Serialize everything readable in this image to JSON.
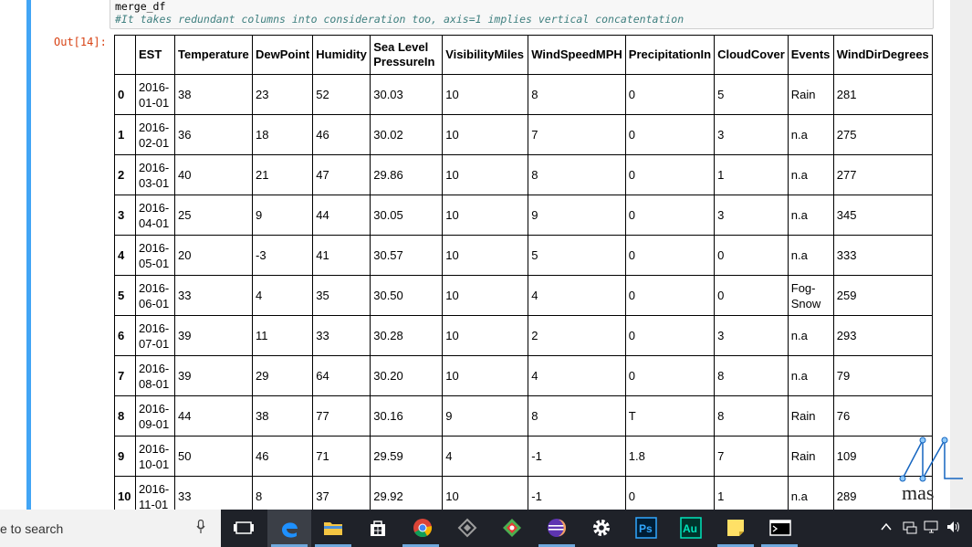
{
  "notebook": {
    "code_line_1": "merge_df",
    "code_line_2": "#It takes redundant columns into consideration too, axis=1 implies vertical concatentation",
    "out_prompt": "Out[14]:"
  },
  "table": {
    "columns": [
      "EST",
      "Temperature",
      "DewPoint",
      "Humidity",
      "Sea Level PressureIn",
      "VisibilityMiles",
      "WindSpeedMPH",
      "PrecipitationIn",
      "CloudCover",
      "Events",
      "WindDirDegrees"
    ],
    "rows": [
      {
        "index": "0",
        "cells": [
          "2016-01-01",
          "38",
          "23",
          "52",
          "30.03",
          "10",
          "8",
          "0",
          "5",
          "Rain",
          "281"
        ]
      },
      {
        "index": "1",
        "cells": [
          "2016-02-01",
          "36",
          "18",
          "46",
          "30.02",
          "10",
          "7",
          "0",
          "3",
          "n.a",
          "275"
        ]
      },
      {
        "index": "2",
        "cells": [
          "2016-03-01",
          "40",
          "21",
          "47",
          "29.86",
          "10",
          "8",
          "0",
          "1",
          "n.a",
          "277"
        ]
      },
      {
        "index": "3",
        "cells": [
          "2016-04-01",
          "25",
          "9",
          "44",
          "30.05",
          "10",
          "9",
          "0",
          "3",
          "n.a",
          "345"
        ]
      },
      {
        "index": "4",
        "cells": [
          "2016-05-01",
          "20",
          "-3",
          "41",
          "30.57",
          "10",
          "5",
          "0",
          "0",
          "n.a",
          "333"
        ]
      },
      {
        "index": "5",
        "cells": [
          "2016-06-01",
          "33",
          "4",
          "35",
          "30.50",
          "10",
          "4",
          "0",
          "0",
          "Fog-Snow",
          "259"
        ]
      },
      {
        "index": "6",
        "cells": [
          "2016-07-01",
          "39",
          "11",
          "33",
          "30.28",
          "10",
          "2",
          "0",
          "3",
          "n.a",
          "293"
        ]
      },
      {
        "index": "7",
        "cells": [
          "2016-08-01",
          "39",
          "29",
          "64",
          "30.20",
          "10",
          "4",
          "0",
          "8",
          "n.a",
          "79"
        ]
      },
      {
        "index": "8",
        "cells": [
          "2016-09-01",
          "44",
          "38",
          "77",
          "30.16",
          "9",
          "8",
          "T",
          "8",
          "Rain",
          "76"
        ]
      },
      {
        "index": "9",
        "cells": [
          "2016-10-01",
          "50",
          "46",
          "71",
          "29.59",
          "4",
          "-1",
          "1.8",
          "7",
          "Rain",
          "109"
        ]
      },
      {
        "index": "10",
        "cells": [
          "2016-11-01",
          "33",
          "8",
          "37",
          "29.92",
          "10",
          "-1",
          "0",
          "1",
          "n.a",
          "289"
        ]
      }
    ]
  },
  "taskbar": {
    "search_text": "e to search",
    "apps": [
      {
        "name": "task-view-icon",
        "color": "#ffffff"
      },
      {
        "name": "edge-icon",
        "color": "#1e90ff"
      },
      {
        "name": "file-explorer-icon",
        "color": "#f4c542"
      },
      {
        "name": "store-icon",
        "color": "#ffffff"
      },
      {
        "name": "chrome-icon",
        "color": "#db4437"
      },
      {
        "name": "unity-icon",
        "color": "#9e9e9e"
      },
      {
        "name": "gitkraken-icon",
        "color": "#4caf50"
      },
      {
        "name": "eclipse-icon",
        "color": "#7e57c2"
      },
      {
        "name": "settings-icon",
        "color": "#ffffff"
      },
      {
        "name": "photoshop-icon",
        "color": "#31a8ff",
        "text": "Ps"
      },
      {
        "name": "audition-icon",
        "color": "#00e4bb",
        "text": "Au"
      },
      {
        "name": "sticky-notes-icon",
        "color": "#ffe066"
      },
      {
        "name": "terminal-icon",
        "color": "#ffffff"
      }
    ]
  },
  "watermark": {
    "text": "mas"
  },
  "colors": {
    "cell_bar": "#42a5f5",
    "out_prompt": "#d84315",
    "comment": "#408080"
  }
}
